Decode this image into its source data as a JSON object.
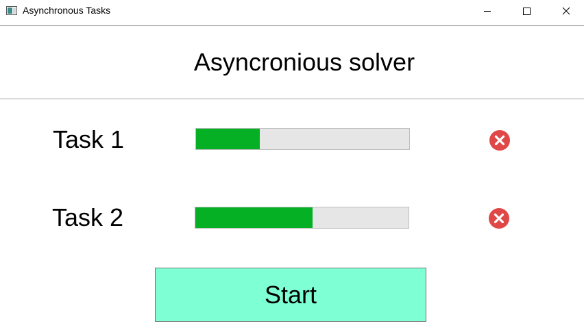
{
  "window": {
    "title": "Asynchronous Tasks"
  },
  "header": {
    "title": "Asyncronious solver"
  },
  "tasks": [
    {
      "label": "Task 1",
      "progress_fraction": 0.3,
      "cancel_icon": "cancel-icon"
    },
    {
      "label": "Task 2",
      "progress_fraction": 0.55,
      "cancel_icon": "cancel-icon"
    }
  ],
  "start_button": {
    "label": "Start"
  },
  "colors": {
    "progress_fill": "#06b025",
    "progress_track": "#e6e6e6",
    "cancel_icon": "#e04848",
    "start_button_bg": "#7fffd4"
  }
}
